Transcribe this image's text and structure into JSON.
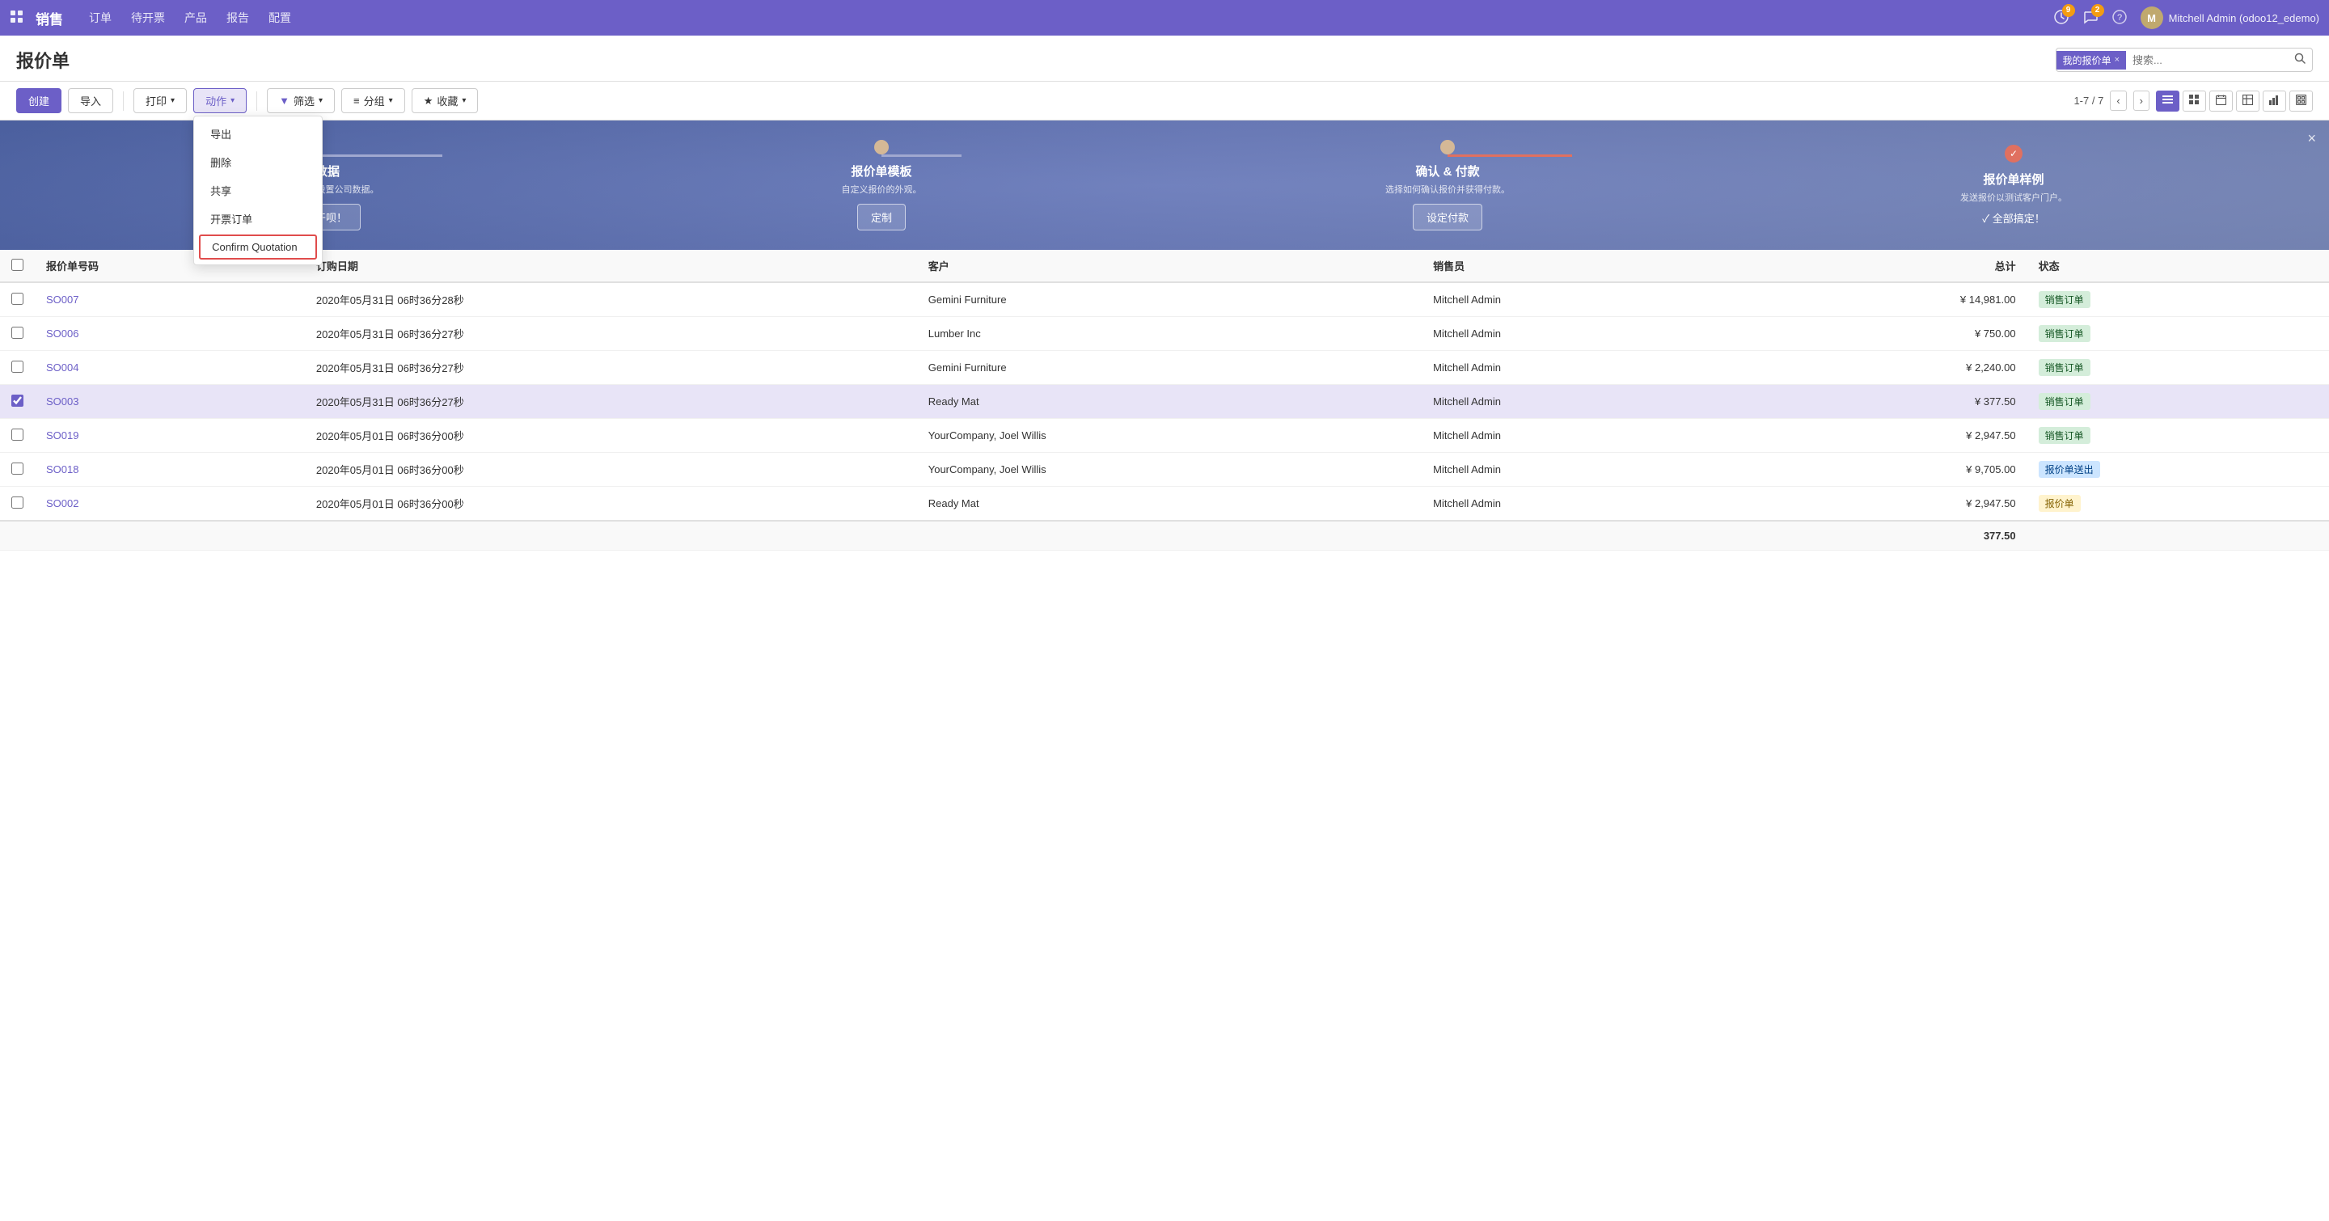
{
  "app": {
    "name": "销售",
    "nav_links": [
      "订单",
      "待开票",
      "产品",
      "报告",
      "配置"
    ],
    "icons": {
      "grid": "⊞",
      "bell": "🔔",
      "chat": "💬",
      "user_icon": "👤"
    },
    "notifications": {
      "activity_count": "9",
      "chat_count": "2"
    },
    "user": {
      "name": "Mitchell Admin (odoo12_edemo)",
      "avatar_initials": "M"
    }
  },
  "page": {
    "title": "报价单",
    "search": {
      "filter_tag": "我的报价单",
      "placeholder": "搜索..."
    }
  },
  "toolbar": {
    "create_label": "创建",
    "import_label": "导入",
    "print_label": "打印",
    "action_label": "动作",
    "filter_label": "筛选",
    "group_label": "分组",
    "fav_label": "收藏",
    "pagination": "1-7 / 7",
    "view_list": "☰",
    "view_kanban": "⊞",
    "view_calendar": "📅",
    "view_pivot": "⊟",
    "view_graph": "📊",
    "view_activity": "⊠"
  },
  "action_menu": {
    "items": [
      "导出",
      "删除",
      "共享",
      "开票订单",
      "Confirm Quotation"
    ]
  },
  "banner": {
    "close_label": "×",
    "steps": [
      {
        "id": "company",
        "title": "公司数据",
        "desc": "给文档页眉/页脚设置公司数据。",
        "btn_label": "咱们开干呗！",
        "dot_type": "normal"
      },
      {
        "id": "template",
        "title": "报价单模板",
        "desc": "自定义报价的外观。",
        "btn_label": "定制",
        "dot_type": "normal"
      },
      {
        "id": "confirm",
        "title": "确认 & 付款",
        "desc": "选择如何确认报价并获得付款。",
        "btn_label": "设定付款",
        "dot_type": "normal"
      },
      {
        "id": "sample",
        "title": "报价单样例",
        "desc": "发送报价以测试客户门户。",
        "check_label": "✓ 全部搞定！",
        "dot_type": "check"
      }
    ]
  },
  "table": {
    "columns": [
      "报价单号码",
      "订购日期",
      "客户",
      "销售员",
      "总计",
      "状态"
    ],
    "rows": [
      {
        "id": "SO007",
        "date": "2020年05月31日 06时36分28秒",
        "customer": "Gemini Furniture",
        "salesperson": "Mitchell Admin",
        "total": "¥ 14,981.00",
        "status": "销售订单",
        "status_type": "sale",
        "checked": false
      },
      {
        "id": "SO006",
        "date": "2020年05月31日 06时36分27秒",
        "customer": "Lumber Inc",
        "salesperson": "Mitchell Admin",
        "total": "¥ 750.00",
        "status": "销售订单",
        "status_type": "sale",
        "checked": false
      },
      {
        "id": "SO004",
        "date": "2020年05月31日 06时36分27秒",
        "customer": "Gemini Furniture",
        "salesperson": "Mitchell Admin",
        "total": "¥ 2,240.00",
        "status": "销售订单",
        "status_type": "sale",
        "checked": false
      },
      {
        "id": "SO003",
        "date": "2020年05月31日 06时36分27秒",
        "customer": "Ready Mat",
        "salesperson": "Mitchell Admin",
        "total": "¥ 377.50",
        "status": "销售订单",
        "status_type": "sale",
        "checked": true
      },
      {
        "id": "SO019",
        "date": "2020年05月01日 06时36分00秒",
        "customer": "YourCompany, Joel Willis",
        "salesperson": "Mitchell Admin",
        "total": "¥ 2,947.50",
        "status": "销售订单",
        "status_type": "sale",
        "checked": false
      },
      {
        "id": "SO018",
        "date": "2020年05月01日 06时36分00秒",
        "customer": "YourCompany, Joel Willis",
        "salesperson": "Mitchell Admin",
        "total": "¥ 9,705.00",
        "status": "报价单送出",
        "status_type": "sent",
        "checked": false
      },
      {
        "id": "SO002",
        "date": "2020年05月01日 06时36分00秒",
        "customer": "Ready Mat",
        "salesperson": "Mitchell Admin",
        "total": "¥ 2,947.50",
        "status": "报价单",
        "status_type": "draft",
        "checked": false
      }
    ],
    "footer_total": "377.50"
  }
}
